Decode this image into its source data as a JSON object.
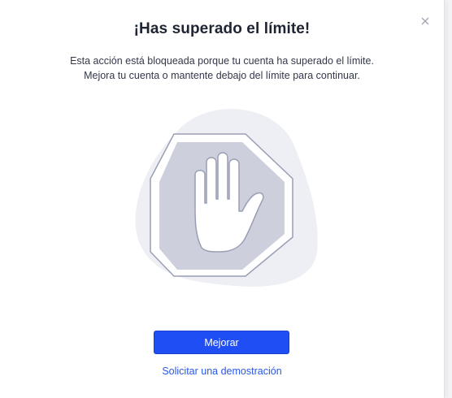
{
  "modal": {
    "title": "¡Has superado el límite!",
    "description_line1": "Esta acción está bloqueada porque tu cuenta ha superado el límite.",
    "description_line2": "Mejora tu cuenta o mantente debajo del límite para continuar.",
    "close_icon": "close-icon",
    "illustration_icon": "stop-hand-icon",
    "upgrade_label": "Mejorar",
    "demo_link_label": "Solicitar una demostración"
  },
  "colors": {
    "primary": "#1f4ef5",
    "link": "#2a57e8",
    "title": "#1f2433",
    "octagon_fill": "#cdd0dc",
    "octagon_border": "#9a9eb4",
    "blob": "#eeeff4"
  }
}
